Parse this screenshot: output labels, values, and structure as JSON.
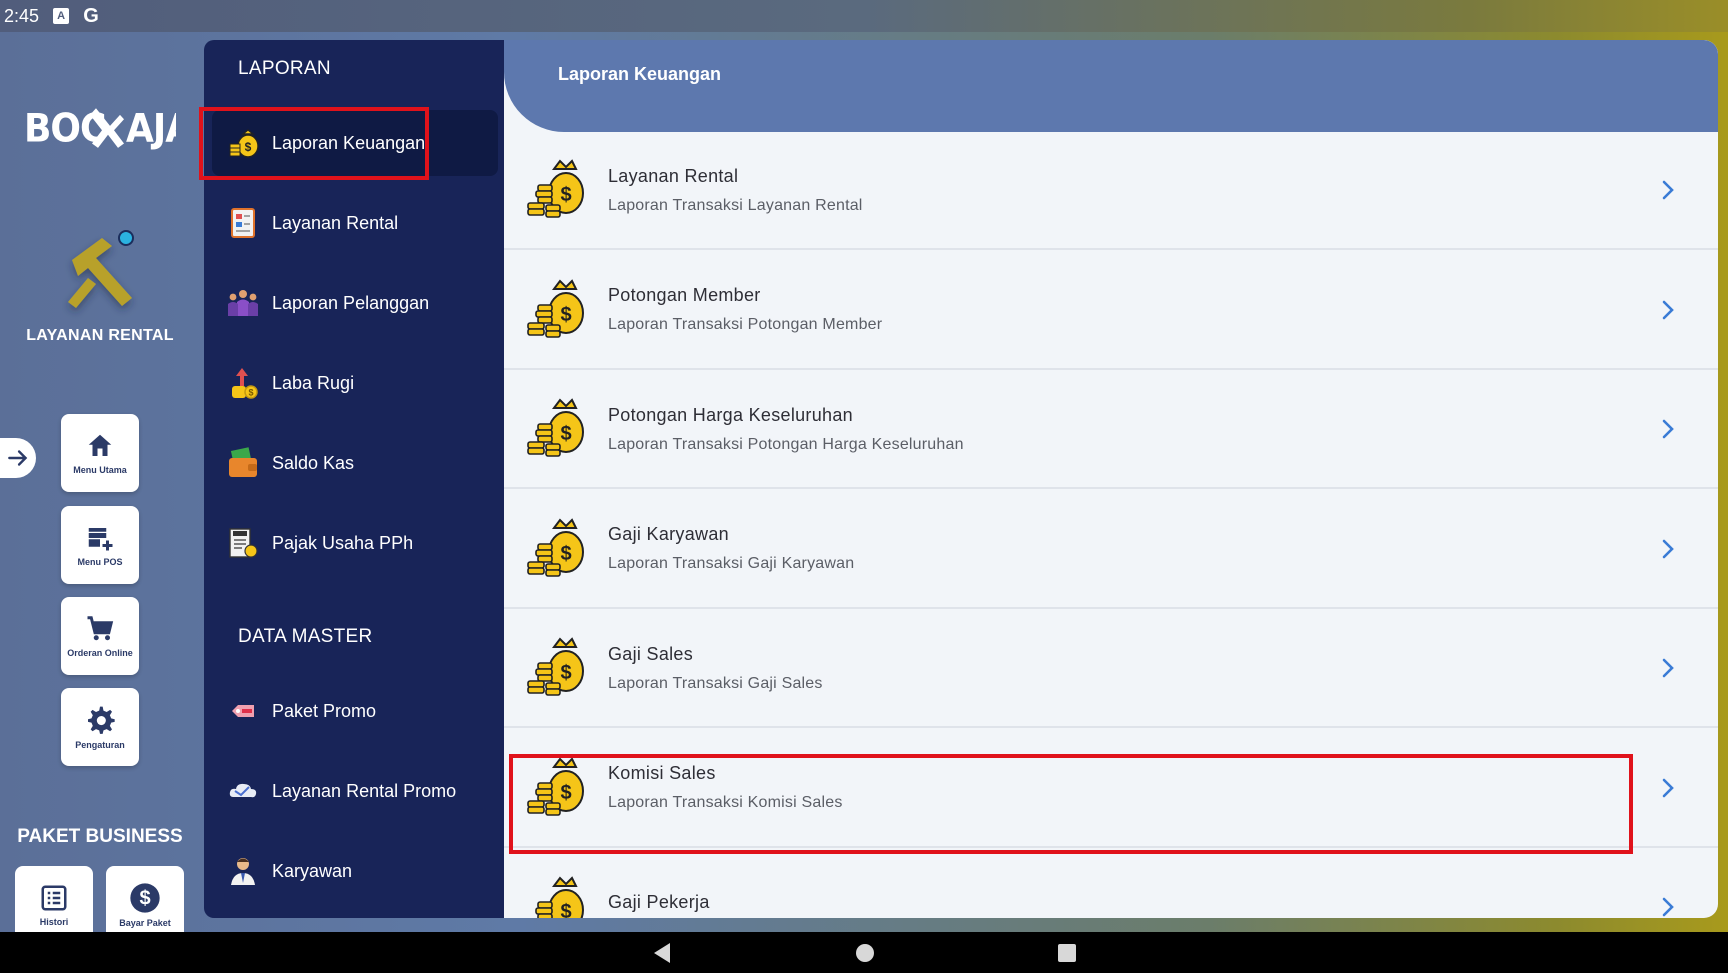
{
  "status_bar": {
    "time": "2:45",
    "icons": [
      "accessibility-icon",
      "google-icon"
    ],
    "g_letter": "G",
    "a_letter": "A"
  },
  "rail": {
    "logo_text": "BOC  AJA",
    "app_name": "LAYANAN RENTAL",
    "buttons": [
      {
        "label": "Menu Utama",
        "icon": "home-icon"
      },
      {
        "label": "Menu POS",
        "icon": "store-add-icon"
      },
      {
        "label": "Orderan Online",
        "icon": "cart-icon"
      },
      {
        "label": "Pengaturan",
        "icon": "gear-icon"
      }
    ],
    "paket_title": "PAKET BUSINESS",
    "small_buttons": [
      {
        "label": "Histori",
        "icon": "list-icon"
      },
      {
        "label": "Bayar Paket",
        "icon": "dollar-icon"
      }
    ]
  },
  "menu": {
    "section_laporan": "LAPORAN",
    "laporan_items": [
      {
        "label": "Laporan Keuangan",
        "icon": "money-bag-icon",
        "active": true
      },
      {
        "label": "Layanan Rental",
        "icon": "report-icon"
      },
      {
        "label": "Laporan Pelanggan",
        "icon": "people-icon"
      },
      {
        "label": "Laba Rugi",
        "icon": "hand-coin-icon"
      },
      {
        "label": "Saldo Kas",
        "icon": "wallet-icon"
      },
      {
        "label": "Pajak Usaha PPh",
        "icon": "tax-icon"
      }
    ],
    "section_master": "DATA MASTER",
    "master_items": [
      {
        "label": "Paket Promo",
        "icon": "promo-tag-icon"
      },
      {
        "label": "Layanan Rental Promo",
        "icon": "promo-cloud-icon"
      },
      {
        "label": "Karyawan",
        "icon": "employee-icon"
      }
    ]
  },
  "content": {
    "header_title": "Laporan Keuangan",
    "rows": [
      {
        "title": "Layanan Rental",
        "subtitle": "Laporan Transaksi Layanan Rental"
      },
      {
        "title": "Potongan Member",
        "subtitle": "Laporan Transaksi Potongan Member"
      },
      {
        "title": "Potongan Harga Keseluruhan",
        "subtitle": "Laporan Transaksi Potongan Harga Keseluruhan"
      },
      {
        "title": "Gaji Karyawan",
        "subtitle": "Laporan Transaksi Gaji Karyawan"
      },
      {
        "title": "Gaji Sales",
        "subtitle": "Laporan Transaksi Gaji Sales"
      },
      {
        "title": "Komisi Sales",
        "subtitle": "Laporan Transaksi Komisi Sales"
      },
      {
        "title": "Gaji Pekerja",
        "subtitle": ""
      }
    ]
  },
  "colors": {
    "accent": "#5d78ae",
    "menu_bg": "#182458",
    "highlight": "#e0121b",
    "gold": "#f5c518"
  }
}
